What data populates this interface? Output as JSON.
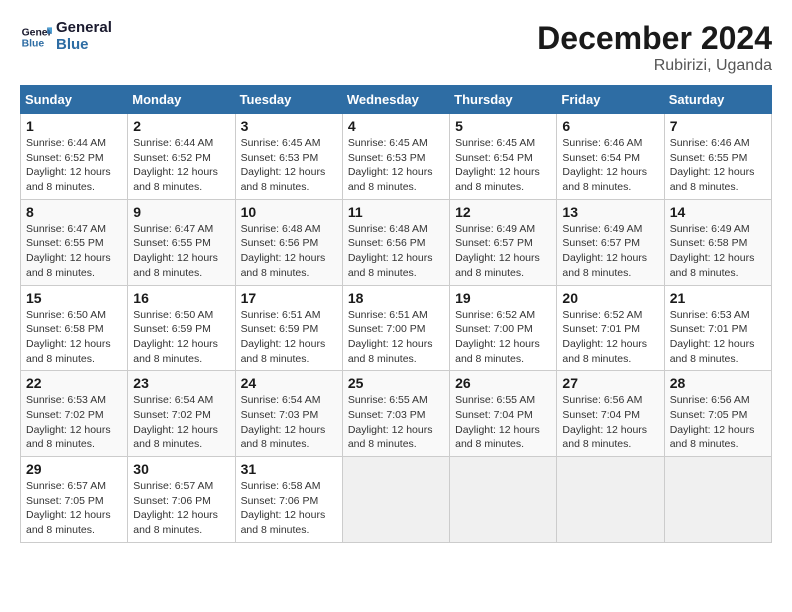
{
  "logo": {
    "text_general": "General",
    "text_blue": "Blue"
  },
  "title": {
    "month_year": "December 2024",
    "location": "Rubirizi, Uganda"
  },
  "weekdays": [
    "Sunday",
    "Monday",
    "Tuesday",
    "Wednesday",
    "Thursday",
    "Friday",
    "Saturday"
  ],
  "weeks": [
    [
      {
        "day": "1",
        "sunrise": "6:44 AM",
        "sunset": "6:52 PM",
        "daylight": "12 hours and 8 minutes."
      },
      {
        "day": "2",
        "sunrise": "6:44 AM",
        "sunset": "6:52 PM",
        "daylight": "12 hours and 8 minutes."
      },
      {
        "day": "3",
        "sunrise": "6:45 AM",
        "sunset": "6:53 PM",
        "daylight": "12 hours and 8 minutes."
      },
      {
        "day": "4",
        "sunrise": "6:45 AM",
        "sunset": "6:53 PM",
        "daylight": "12 hours and 8 minutes."
      },
      {
        "day": "5",
        "sunrise": "6:45 AM",
        "sunset": "6:54 PM",
        "daylight": "12 hours and 8 minutes."
      },
      {
        "day": "6",
        "sunrise": "6:46 AM",
        "sunset": "6:54 PM",
        "daylight": "12 hours and 8 minutes."
      },
      {
        "day": "7",
        "sunrise": "6:46 AM",
        "sunset": "6:55 PM",
        "daylight": "12 hours and 8 minutes."
      }
    ],
    [
      {
        "day": "8",
        "sunrise": "6:47 AM",
        "sunset": "6:55 PM",
        "daylight": "12 hours and 8 minutes."
      },
      {
        "day": "9",
        "sunrise": "6:47 AM",
        "sunset": "6:55 PM",
        "daylight": "12 hours and 8 minutes."
      },
      {
        "day": "10",
        "sunrise": "6:48 AM",
        "sunset": "6:56 PM",
        "daylight": "12 hours and 8 minutes."
      },
      {
        "day": "11",
        "sunrise": "6:48 AM",
        "sunset": "6:56 PM",
        "daylight": "12 hours and 8 minutes."
      },
      {
        "day": "12",
        "sunrise": "6:49 AM",
        "sunset": "6:57 PM",
        "daylight": "12 hours and 8 minutes."
      },
      {
        "day": "13",
        "sunrise": "6:49 AM",
        "sunset": "6:57 PM",
        "daylight": "12 hours and 8 minutes."
      },
      {
        "day": "14",
        "sunrise": "6:49 AM",
        "sunset": "6:58 PM",
        "daylight": "12 hours and 8 minutes."
      }
    ],
    [
      {
        "day": "15",
        "sunrise": "6:50 AM",
        "sunset": "6:58 PM",
        "daylight": "12 hours and 8 minutes."
      },
      {
        "day": "16",
        "sunrise": "6:50 AM",
        "sunset": "6:59 PM",
        "daylight": "12 hours and 8 minutes."
      },
      {
        "day": "17",
        "sunrise": "6:51 AM",
        "sunset": "6:59 PM",
        "daylight": "12 hours and 8 minutes."
      },
      {
        "day": "18",
        "sunrise": "6:51 AM",
        "sunset": "7:00 PM",
        "daylight": "12 hours and 8 minutes."
      },
      {
        "day": "19",
        "sunrise": "6:52 AM",
        "sunset": "7:00 PM",
        "daylight": "12 hours and 8 minutes."
      },
      {
        "day": "20",
        "sunrise": "6:52 AM",
        "sunset": "7:01 PM",
        "daylight": "12 hours and 8 minutes."
      },
      {
        "day": "21",
        "sunrise": "6:53 AM",
        "sunset": "7:01 PM",
        "daylight": "12 hours and 8 minutes."
      }
    ],
    [
      {
        "day": "22",
        "sunrise": "6:53 AM",
        "sunset": "7:02 PM",
        "daylight": "12 hours and 8 minutes."
      },
      {
        "day": "23",
        "sunrise": "6:54 AM",
        "sunset": "7:02 PM",
        "daylight": "12 hours and 8 minutes."
      },
      {
        "day": "24",
        "sunrise": "6:54 AM",
        "sunset": "7:03 PM",
        "daylight": "12 hours and 8 minutes."
      },
      {
        "day": "25",
        "sunrise": "6:55 AM",
        "sunset": "7:03 PM",
        "daylight": "12 hours and 8 minutes."
      },
      {
        "day": "26",
        "sunrise": "6:55 AM",
        "sunset": "7:04 PM",
        "daylight": "12 hours and 8 minutes."
      },
      {
        "day": "27",
        "sunrise": "6:56 AM",
        "sunset": "7:04 PM",
        "daylight": "12 hours and 8 minutes."
      },
      {
        "day": "28",
        "sunrise": "6:56 AM",
        "sunset": "7:05 PM",
        "daylight": "12 hours and 8 minutes."
      }
    ],
    [
      {
        "day": "29",
        "sunrise": "6:57 AM",
        "sunset": "7:05 PM",
        "daylight": "12 hours and 8 minutes."
      },
      {
        "day": "30",
        "sunrise": "6:57 AM",
        "sunset": "7:06 PM",
        "daylight": "12 hours and 8 minutes."
      },
      {
        "day": "31",
        "sunrise": "6:58 AM",
        "sunset": "7:06 PM",
        "daylight": "12 hours and 8 minutes."
      },
      null,
      null,
      null,
      null
    ]
  ],
  "labels": {
    "sunrise_prefix": "Sunrise:",
    "sunset_prefix": "Sunset:",
    "daylight_prefix": "Daylight:"
  }
}
